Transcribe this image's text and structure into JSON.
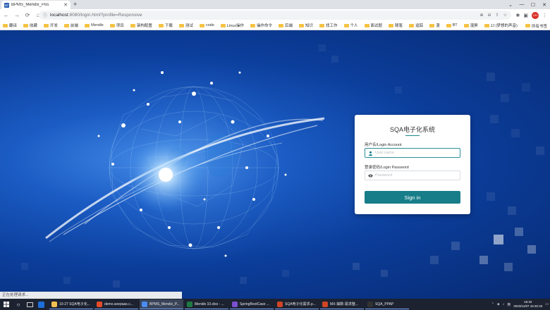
{
  "browser": {
    "tab_title": "BPMS_Mendix_Pos",
    "tab_favicon": "BP",
    "url_host": "localhost",
    "url_path": ":8080/login.html?profile=Responsive",
    "profile_initials": "CH"
  },
  "bookmarks": [
    "翻译",
    "收藏",
    "开发",
    "前端",
    "Mendix",
    "项目",
    "架构配置",
    "下载",
    "测试",
    "code",
    "Linux操作",
    "操作命令",
    "后端",
    "知识",
    "找工作",
    "个人",
    "面试题",
    "随笔",
    "追踪",
    "漫",
    "BT",
    "漫屏",
    "JJ (梦想的声音)"
  ],
  "bookmarks_right": "所有书签",
  "login": {
    "title": "SQA电子化系统",
    "username_label": "用户名/Login Account",
    "username_placeholder": "User name",
    "password_label": "登录密码/Login Password",
    "password_placeholder": "Password",
    "signin_label": "Sign in",
    "accent_color": "#177e89"
  },
  "status_text": "正在处理请求...",
  "taskbar": {
    "apps": [
      {
        "label": "10-27 SQA电子化...",
        "color": "#f0c050",
        "active": false
      },
      {
        "label": "demo.avepaas.c...",
        "color": "#e34c26",
        "active": false
      },
      {
        "label": "BPMS_Mendix_P...",
        "color": "#4a8cf0",
        "active": true
      },
      {
        "label": "Mendix 10.xlsx - ...",
        "color": "#1f7a43",
        "active": false
      },
      {
        "label": "SpringBootCase ...",
        "color": "#7b4fd0",
        "active": false
      },
      {
        "label": "SQA电子化需求.p...",
        "color": "#d04526",
        "active": false
      },
      {
        "label": "MX-抽数-需求整...",
        "color": "#d04526",
        "active": false
      },
      {
        "label": "SQA_PPAP",
        "color": "#333333",
        "active": false
      }
    ],
    "time": "15:32",
    "date": "2023/11/07 15:32:43"
  }
}
